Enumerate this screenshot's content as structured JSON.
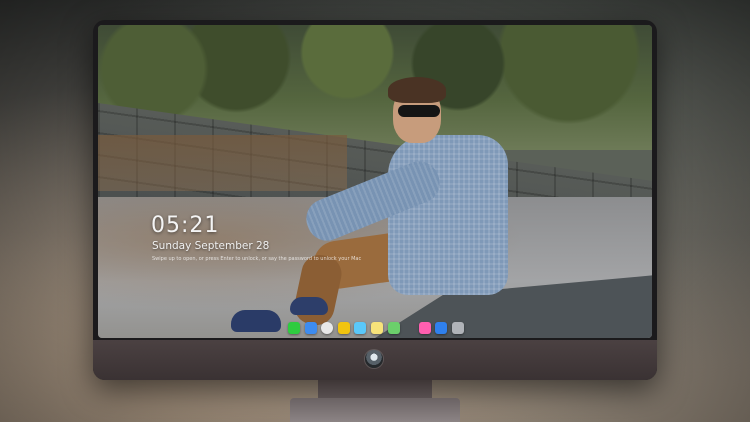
{
  "lock_screen": {
    "time": "05:21",
    "date": "Sunday September 28",
    "hint": "Swipe up to open, or press Enter to unlock, or say the password to unlock your Mac"
  },
  "dock": {
    "icons": [
      {
        "name": "messages-icon",
        "color": "#2ecc40"
      },
      {
        "name": "finder-icon",
        "color": "#3d8cf0"
      },
      {
        "name": "clock-icon",
        "color": "#e8e8e8"
      },
      {
        "name": "photos-icon",
        "color": "#f1c40f"
      },
      {
        "name": "files-icon",
        "color": "#5ac8fa"
      },
      {
        "name": "notes-icon",
        "color": "#f7e37a"
      },
      {
        "name": "maps-icon",
        "color": "#6bcf6b"
      },
      {
        "name": "music-icon",
        "color": "#ff5fb0"
      },
      {
        "name": "app-store-icon",
        "color": "#2f80ed"
      },
      {
        "name": "camera-icon",
        "color": "#b0b3b8"
      }
    ]
  }
}
